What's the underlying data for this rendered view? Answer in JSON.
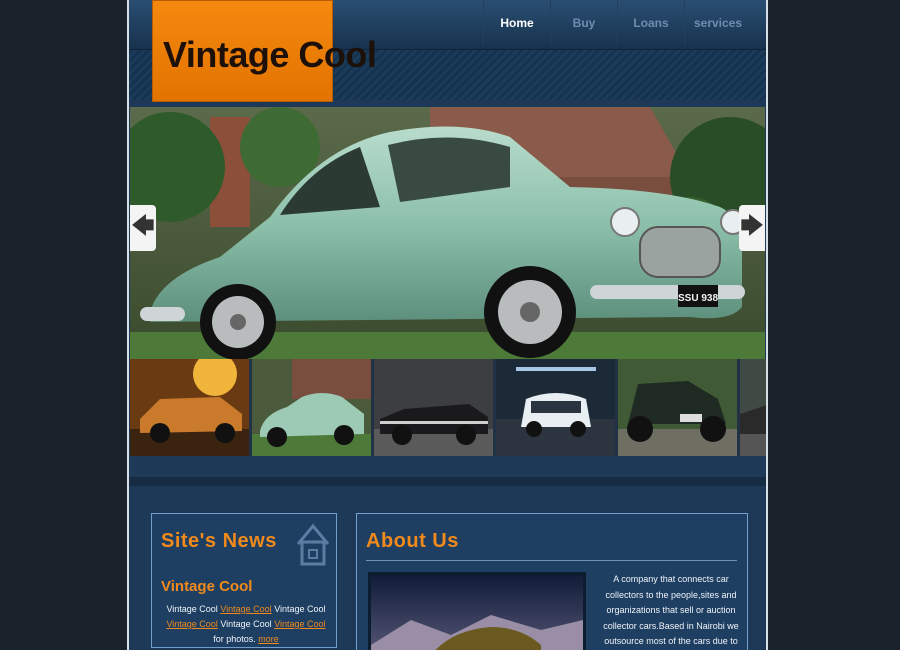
{
  "site": {
    "logo_text": "Vintage Cool"
  },
  "nav": {
    "items": [
      "Home",
      "Buy",
      "Loans",
      "services"
    ]
  },
  "slider": {
    "plate_text": "SSU 938",
    "prev_symbol": "🡄",
    "next_symbol": "🡆"
  },
  "thumbnails": [
    {
      "label": "orange-sunset-muscle-car"
    },
    {
      "label": "green-aston-martin"
    },
    {
      "label": "black-convertible"
    },
    {
      "label": "white-mini-cooper"
    },
    {
      "label": "vintage-bentley"
    },
    {
      "label": "partial-classic-car"
    }
  ],
  "news": {
    "title": "Site's News",
    "heading": "Vintage Cool",
    "text_parts": [
      {
        "t": "Vintage Cool ",
        "link": false
      },
      {
        "t": "Vintage Cool",
        "link": true
      },
      {
        "t": " Vintage Cool ",
        "link": false
      },
      {
        "t": "Vintage Cool",
        "link": true
      },
      {
        "t": " Vintage Cool ",
        "link": false
      },
      {
        "t": "Vintage Cool",
        "link": true
      },
      {
        "t": " for photos. ",
        "link": false
      },
      {
        "t": "more",
        "link": true
      }
    ]
  },
  "about": {
    "title": "About Us",
    "text": "A company that connects car collectors to the people,sites and organizations that sell or auction collector cars.Based in Nairobi we outsource most of the cars due to Kenya banning importation of old"
  },
  "colors": {
    "accent": "#f08a1c",
    "logo_bg": "#f5890f",
    "page_bg": "#1d3957",
    "body_bg": "#1a232c"
  }
}
